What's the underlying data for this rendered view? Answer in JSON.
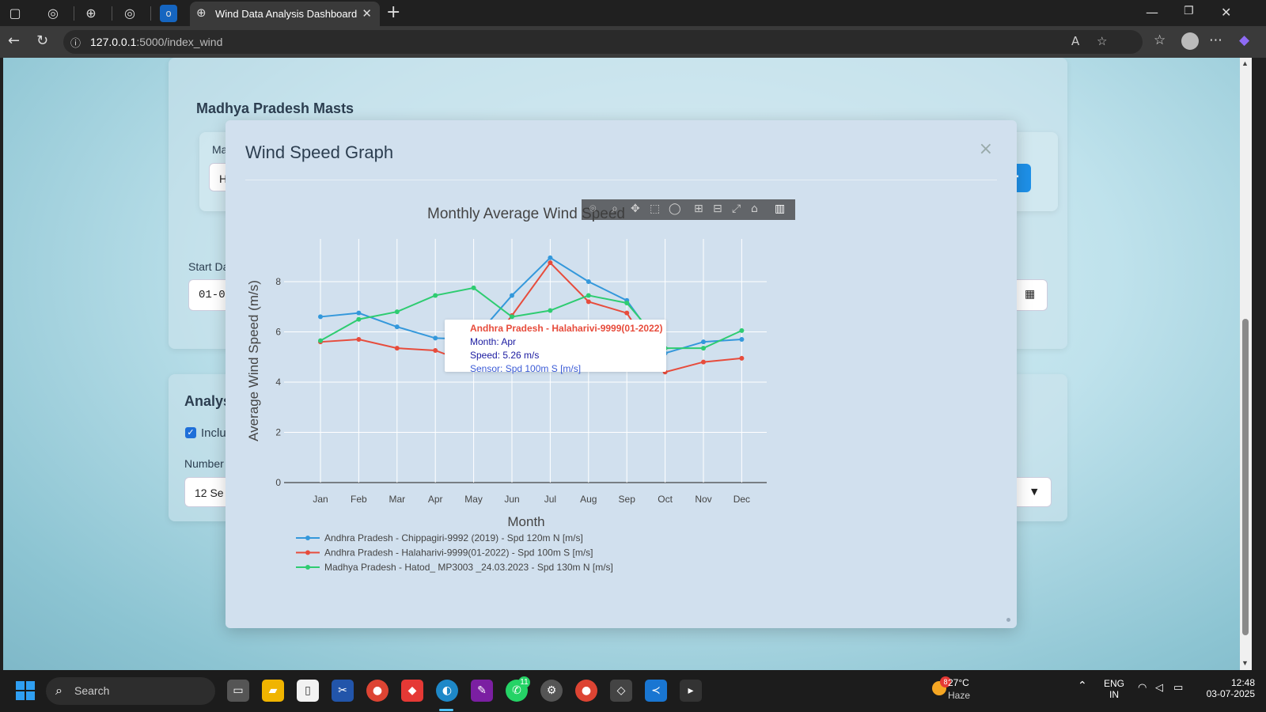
{
  "browser": {
    "tab_title": "Wind Data Analysis Dashboard",
    "url_host": "127.0.0.1",
    "url_path": ":5000/index_wind"
  },
  "page": {
    "section_title": "Madhya Pradesh Masts",
    "mast_label_partial": "Ma",
    "mast_value_partial": "H",
    "start_date_label_partial": "Start Da",
    "start_date_value_partial": "01-0",
    "analysis_title_partial": "Analys",
    "include_label_partial": "Inclu",
    "number_label_partial": "Number",
    "select_value_partial": "12 Se"
  },
  "modal": {
    "title": "Wind Speed Graph",
    "close_glyph": "×"
  },
  "tooltip": {
    "series": "Andhra Pradesh - Halaharivi-9999(01-2022)",
    "month": "Month: Apr",
    "speed": "Speed: 5.26 m/s",
    "sensor": "Sensor: Spd 100m S [m/s]"
  },
  "chart_data": {
    "type": "line",
    "title": "Monthly Average Wind Speed",
    "xlabel": "Month",
    "ylabel": "Average Wind Speed (m/s)",
    "categories": [
      "Jan",
      "Feb",
      "Mar",
      "Apr",
      "May",
      "Jun",
      "Jul",
      "Aug",
      "Sep",
      "Oct",
      "Nov",
      "Dec"
    ],
    "ylim": [
      0,
      9.7
    ],
    "yticks": [
      0,
      2,
      4,
      6,
      8
    ],
    "grid": true,
    "legend_position": "bottom-left",
    "series": [
      {
        "name": "Andhra Pradesh - Chippagiri-9992 (2019) - Spd 120m N [m/s]",
        "color": "#3498db",
        "values": [
          6.6,
          6.75,
          6.2,
          5.75,
          5.7,
          7.45,
          8.95,
          8.0,
          7.25,
          5.15,
          5.6,
          5.7
        ]
      },
      {
        "name": "Andhra Pradesh - Halaharivi-9999(01-2022) - Spd 100m S [m/s]",
        "color": "#e74c3c",
        "values": [
          5.6,
          5.7,
          5.35,
          5.26,
          4.7,
          6.65,
          8.75,
          7.2,
          6.75,
          4.4,
          4.8,
          4.95
        ]
      },
      {
        "name": "Madhya Pradesh - Hatod_ MP3003 _24.03.2023 - Spd 130m N [m/s]",
        "color": "#2ecc71",
        "values": [
          5.65,
          6.5,
          6.8,
          7.45,
          7.75,
          6.6,
          6.85,
          7.45,
          7.15,
          5.35,
          5.35,
          6.05
        ]
      }
    ]
  },
  "taskbar": {
    "search_label": "Search",
    "temperature": "27°C",
    "condition": "Haze",
    "weather_badge": "8",
    "lang1": "ENG",
    "lang2": "IN",
    "time": "12:48",
    "date": "03-07-2025",
    "whatsapp_badge": "11"
  }
}
